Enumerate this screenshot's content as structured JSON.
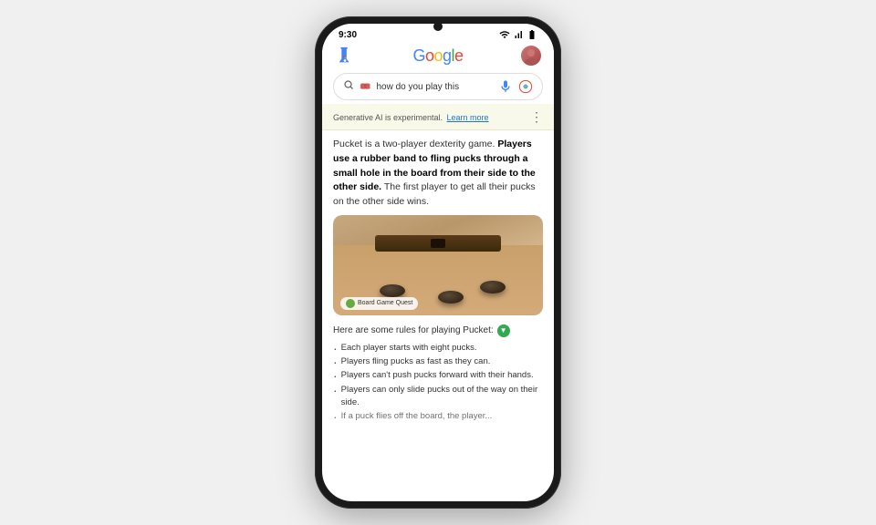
{
  "phone": {
    "status_bar": {
      "time": "9:30"
    },
    "header": {
      "google_logo": "Google",
      "search_query_emoji": "🎟️",
      "search_placeholder": "how do you play this"
    },
    "ai_banner": {
      "text": "Generative AI is experimental.",
      "link_text": "Learn more"
    },
    "answer": {
      "intro": "Pucket is a two-player dexterity game.",
      "bold_part": "Players use a rubber band to fling pucks through a small hole in the board from their side to the other side.",
      "rest": " The first player to get all their pucks on the other side wins."
    },
    "image": {
      "source_name": "Board Game Quest"
    },
    "rules": {
      "header": "Here are some rules for playing Pucket:",
      "items": [
        "Each player starts with eight pucks.",
        "Players fling pucks as fast as they can.",
        "Players can't push pucks forward with their hands.",
        "Players can only slide pucks out of the way on their side.",
        "If a puck flies off the board, the player..."
      ]
    }
  }
}
